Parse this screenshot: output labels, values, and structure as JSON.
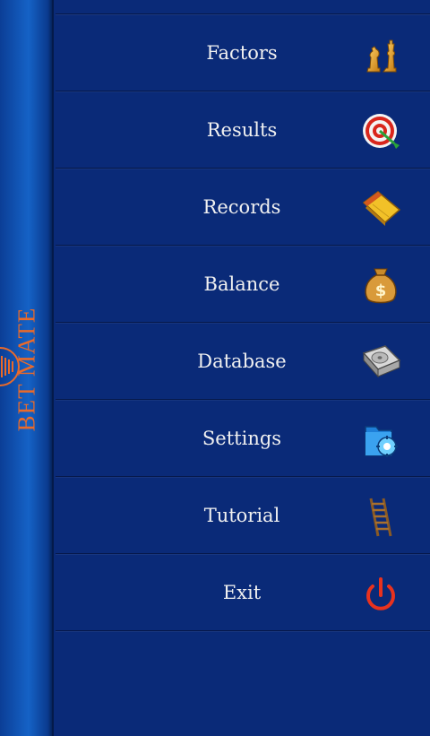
{
  "sidebar": {
    "brand": "BET MATE"
  },
  "menu": {
    "items": [
      {
        "label": "Factors",
        "icon": "chess-pieces-icon"
      },
      {
        "label": "Results",
        "icon": "target-icon"
      },
      {
        "label": "Records",
        "icon": "notepad-icon"
      },
      {
        "label": "Balance",
        "icon": "money-bag-icon"
      },
      {
        "label": "Database",
        "icon": "hard-drive-icon"
      },
      {
        "label": "Settings",
        "icon": "settings-folder-icon"
      },
      {
        "label": "Tutorial",
        "icon": "ladder-icon"
      },
      {
        "label": "Exit",
        "icon": "power-icon"
      }
    ]
  },
  "colors": {
    "background": "#0a2a78",
    "brand": "#ea6a2a",
    "text": "#f1f1f1",
    "divider": "#06184a"
  }
}
